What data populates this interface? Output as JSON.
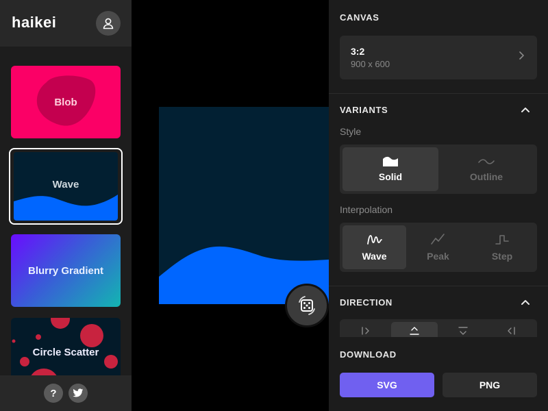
{
  "app": {
    "logo": "haikei"
  },
  "sidebar": {
    "items": [
      {
        "label": "Blob"
      },
      {
        "label": "Wave"
      },
      {
        "label": "Blurry Gradient"
      },
      {
        "label": "Circle Scatter"
      }
    ],
    "footer": {
      "help": "?"
    }
  },
  "panel": {
    "canvas": {
      "title": "CANVAS",
      "ratio": "3:2",
      "dims": "900 x 600"
    },
    "variants": {
      "title": "VARIANTS",
      "style_label": "Style",
      "style_options": [
        "Solid",
        "Outline"
      ],
      "style_selected": "Solid",
      "interp_label": "Interpolation",
      "interp_options": [
        "Wave",
        "Peak",
        "Step"
      ],
      "interp_selected": "Wave"
    },
    "direction": {
      "title": "DIRECTION"
    },
    "download": {
      "title": "DOWNLOAD",
      "svg": "SVG",
      "png": "PNG"
    }
  },
  "colors": {
    "blob_bg": "#fb0066",
    "wave_bg": "#022033",
    "wave_fill": "#0066ff",
    "accent": "#7060f0"
  }
}
